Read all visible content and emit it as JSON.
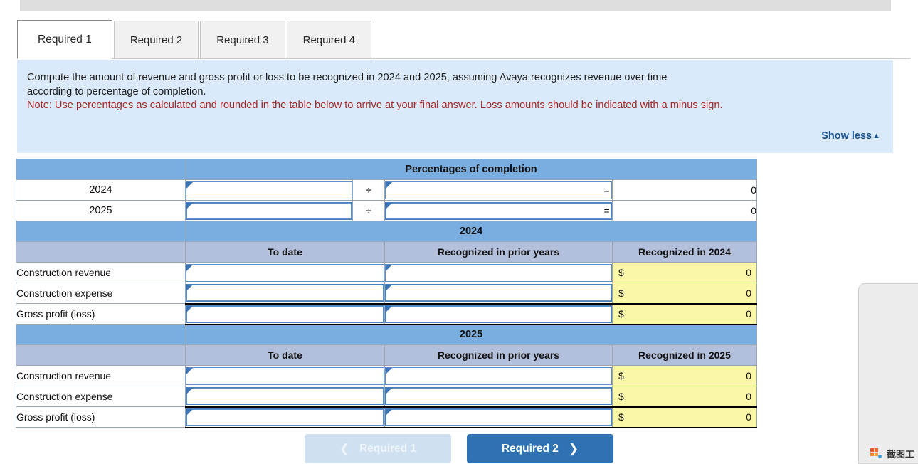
{
  "colors": {
    "band_blue": "#7aaee0",
    "subhead_blue": "#b3c0dc",
    "instruction_bg": "#daeafa",
    "note_red": "#a32626",
    "link_blue": "#1a5494",
    "computed_yellow": "#faf8a8",
    "next_button_blue": "#2f72b4",
    "prev_button_blue": "#cfe0f0"
  },
  "tabs": [
    {
      "label": "Required 1",
      "active": true
    },
    {
      "label": "Required 2",
      "active": false
    },
    {
      "label": "Required 3",
      "active": false
    },
    {
      "label": "Required 4",
      "active": false
    }
  ],
  "instruction": {
    "line1": "Compute the amount of revenue and gross profit or loss to be recognized in 2024 and 2025, assuming Avaya recognizes revenue over time",
    "line2": "according to percentage of completion.",
    "note": "Note: Use percentages as calculated and rounded in the table below to arrive at your final answer. Loss amounts should be indicated with a minus sign.",
    "show_less_label": "Show less",
    "show_less_caret": "▲"
  },
  "table": {
    "percentages_header": "Percentages of completion",
    "divide_symbol": "÷",
    "equals_symbol": "=",
    "dollar_symbol": "$",
    "percentage_rows": [
      {
        "year": "2024",
        "numerator": "",
        "denominator": "",
        "result": "0"
      },
      {
        "year": "2025",
        "numerator": "",
        "denominator": "",
        "result": "0"
      }
    ],
    "sections": [
      {
        "year_band": "2024",
        "blank_label": "",
        "col_to_date": "To date",
        "col_prior": "Recognized in prior years",
        "col_recognized": "Recognized in 2024",
        "rows": [
          {
            "label": "Construction revenue",
            "to_date": "",
            "prior": "",
            "recognized": "0"
          },
          {
            "label": "Construction expense",
            "to_date": "",
            "prior": "",
            "recognized": "0"
          },
          {
            "label": "Gross profit (loss)",
            "to_date": "",
            "prior": "",
            "recognized": "0"
          }
        ]
      },
      {
        "year_band": "2025",
        "blank_label": "",
        "col_to_date": "To date",
        "col_prior": "Recognized in prior years",
        "col_recognized": "Recognized in 2025",
        "rows": [
          {
            "label": "Construction revenue",
            "to_date": "",
            "prior": "",
            "recognized": "0"
          },
          {
            "label": "Construction expense",
            "to_date": "",
            "prior": "",
            "recognized": "0"
          },
          {
            "label": "Gross profit (loss)",
            "to_date": "",
            "prior": "",
            "recognized": "0"
          }
        ]
      }
    ]
  },
  "nav": {
    "prev_label": "Required 1",
    "prev_chevron": "❮",
    "next_label": "Required 2",
    "next_chevron": "❯"
  },
  "float_panel": {
    "item_label": "截图工"
  }
}
